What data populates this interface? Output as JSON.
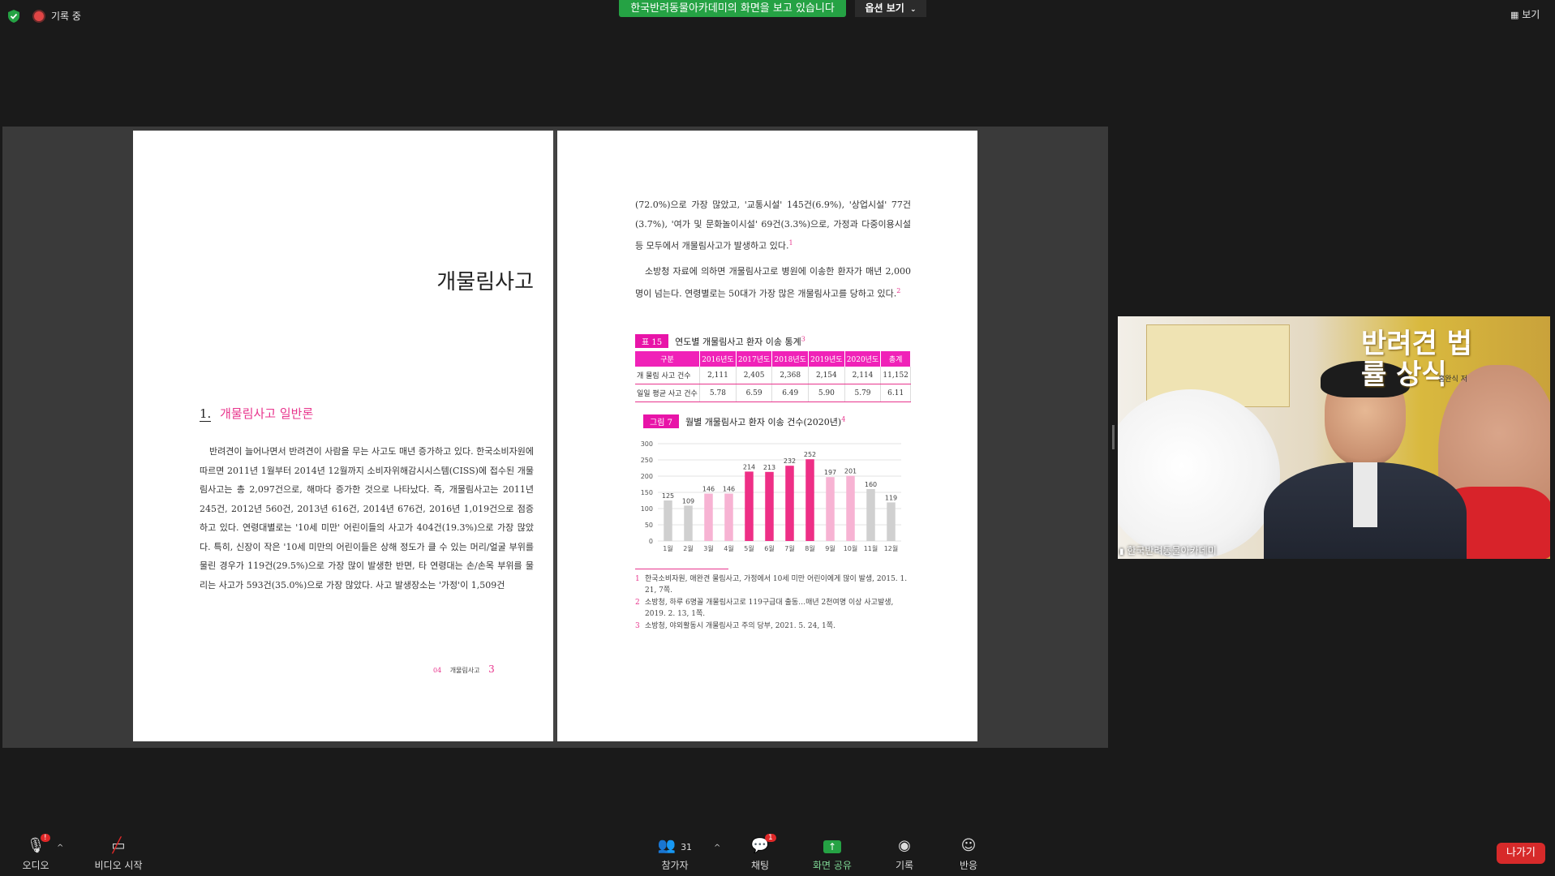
{
  "top_bar": {
    "recording_label": "기록 중",
    "share_banner": "한국반려동물아카데미의 화면을 보고 있습니다",
    "view_options": "옵션 보기",
    "view_button": "보기"
  },
  "left_page": {
    "chapter_title": "개물림사고",
    "section_number": "1.",
    "section_title": "개물림사고 일반론",
    "body": "반려견이 늘어나면서 반려견이 사람을 무는 사고도 매년 증가하고 있다. 한국소비자원에 따르면 2011년 1월부터 2014년 12월까지 소비자위해감시시스템(CISS)에 접수된 개물림사고는 총 2,097건으로, 해마다 증가한 것으로 나타났다. 즉, 개물림사고는 2011년 245건, 2012년 560건, 2013년 616건, 2014년 676건, 2016년 1,019건으로 점증하고 있다. 연령대별로는 '10세 미만' 어린이들의 사고가 404건(19.3%)으로 가장 많았다. 특히, 신장이 작은 '10세 미만의 어린이들은 상해 정도가 클 수 있는 머리/얼굴 부위를 물린 경우가 119건(29.5%)으로 가장 많이 발생한 반면, 타 연령대는 손/손목 부위를 물리는 사고가 593건(35.0%)으로 가장 많았다. 사고 발생장소는 '가정'이 1,509건",
    "footer_chapter": "04",
    "footer_title": "개물림사고",
    "footer_page": "3"
  },
  "right_page": {
    "p1": "(72.0%)으로 가장 많았고, '교통시설' 145건(6.9%), '상업시설' 77건(3.7%), '여가 및 문화놀이시설' 69건(3.3%)으로, 가정과 다중이용시설 등 모두에서 개물림사고가 발생하고 있다.",
    "p1_sup": "1",
    "p2": "소방청 자료에 의하면 개물림사고로 병원에 이송한 환자가 매년 2,000명이 넘는다. 연령별로는 50대가 가장 많은 개물림사고를 당하고 있다.",
    "p2_sup": "2",
    "table_tag": "표 15",
    "table_caption": "연도별 개물림사고 환자 이송 통계",
    "table_caption_sup": "3",
    "table_headers": [
      "구분",
      "2016년도",
      "2017년도",
      "2018년도",
      "2019년도",
      "2020년도",
      "총계"
    ],
    "table_rows": [
      [
        "개 물림 사고 건수",
        "2,111",
        "2,405",
        "2,368",
        "2,154",
        "2,114",
        "11,152"
      ],
      [
        "일일 평균 사고 건수",
        "5.78",
        "6.59",
        "6.49",
        "5.90",
        "5.79",
        "6.11"
      ]
    ],
    "figure_tag": "그림 7",
    "figure_caption": "월별 개물림사고 환자 이송 건수(2020년)",
    "figure_caption_sup": "4",
    "footnotes": [
      {
        "n": "1",
        "text": "한국소비자원, 애완견 물림사고, 가정에서 10세 미만 어린이에게 많이 발생, 2015. 1. 21, 7쪽."
      },
      {
        "n": "2",
        "text": "소방청, 하루 6명꼴 개물림사고로 119구급대 출동…매년 2천여명 이상 사고발생, 2019. 2. 13, 1쪽."
      },
      {
        "n": "3",
        "text": "소방청, 야외활동시 개물림사고 주의 당부, 2021. 5. 24, 1쪽."
      }
    ]
  },
  "chart_data": {
    "type": "bar",
    "categories": [
      "1월",
      "2월",
      "3월",
      "4월",
      "5월",
      "6월",
      "7월",
      "8월",
      "9월",
      "10월",
      "11월",
      "12월"
    ],
    "values": [
      125,
      109,
      146,
      146,
      214,
      213,
      232,
      252,
      197,
      201,
      160,
      119
    ],
    "ylim": [
      0,
      300
    ],
    "yticks": [
      0,
      50,
      100,
      150,
      200,
      250,
      300
    ],
    "bar_colors": [
      "#d0d0d0",
      "#d0d0d0",
      "#f7b3d3",
      "#f7b3d3",
      "#ee2f86",
      "#ee2f86",
      "#ee2f86",
      "#ee2f86",
      "#f7b3d3",
      "#f7b3d3",
      "#d0d0d0",
      "#d0d0d0"
    ],
    "grid": true
  },
  "webcam": {
    "participant_name": "한국반려동물아카데미",
    "book_title": "반려견 법률 상식",
    "book_author": "홍완식 저"
  },
  "toolbar": {
    "audio": "오디오",
    "audio_badge": "!",
    "video": "비디오 시작",
    "participants": "참가자",
    "participants_count": "31",
    "chat": "채팅",
    "chat_badge": "1",
    "share": "화면 공유",
    "record": "기록",
    "reactions": "반응",
    "leave": "나가기"
  }
}
